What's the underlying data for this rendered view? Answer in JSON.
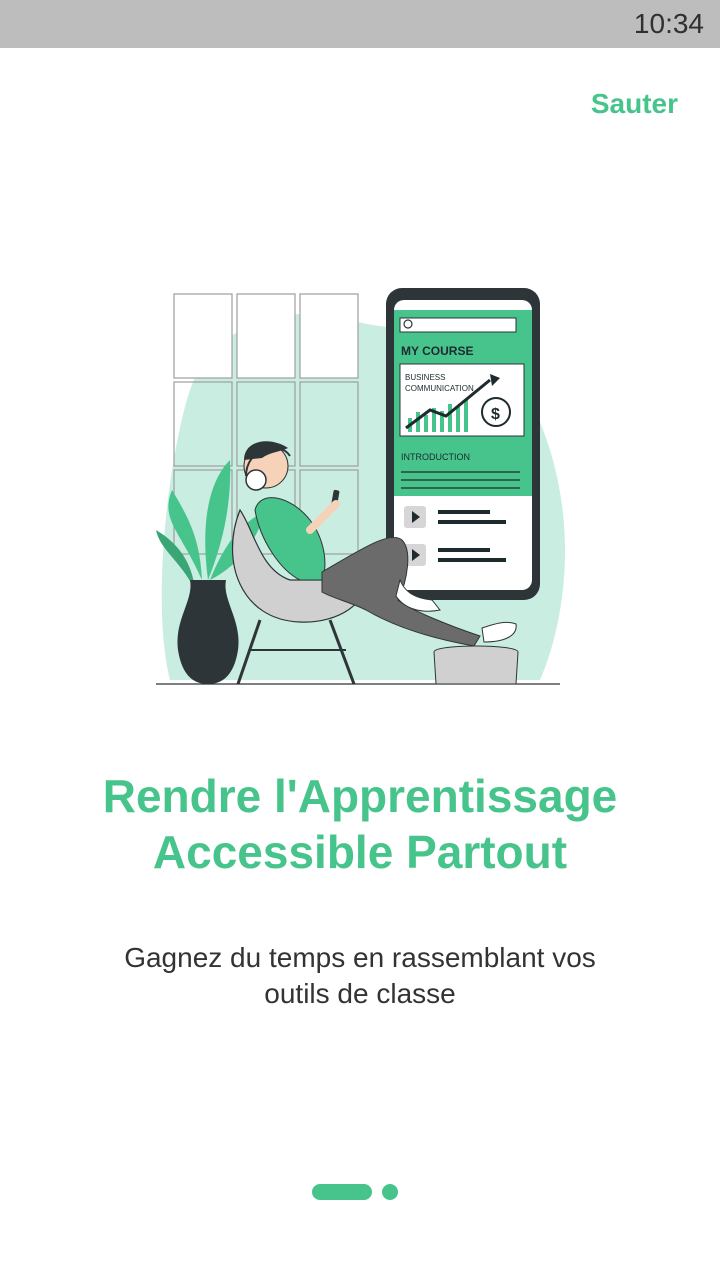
{
  "status_bar": {
    "time": "10:34"
  },
  "header": {
    "skip_label": "Sauter"
  },
  "illustration": {
    "phone_heading": "MY COURSE",
    "card_line1": "BUSINESS",
    "card_line2": "COMMUNICATION",
    "section_label": "INTRODUCTION",
    "accent_color": "#46c48b"
  },
  "onboarding": {
    "title_line1": "Rendre l'Apprentissage",
    "title_line2": "Accessible Partout",
    "subtitle": "Gagnez du temps en rassemblant vos outils de classe"
  },
  "page_indicator": {
    "current_page": 1,
    "total_pages": 2
  }
}
